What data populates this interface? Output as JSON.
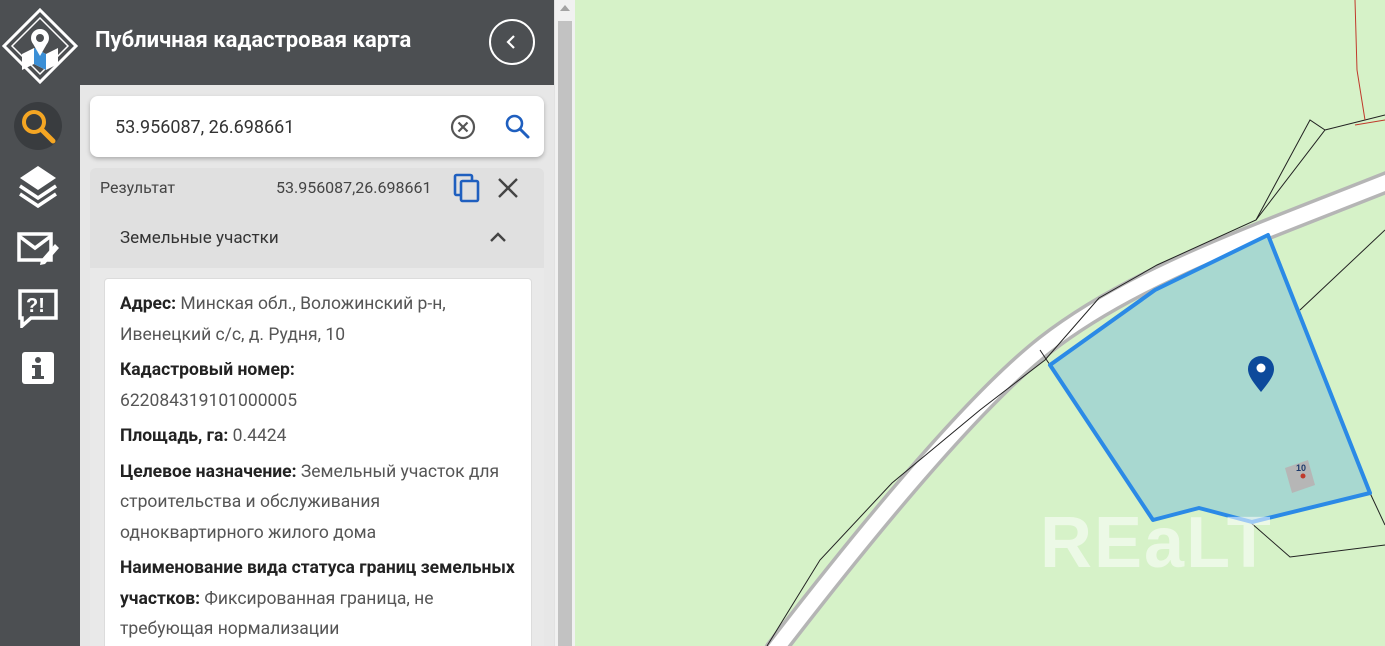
{
  "app": {
    "title": "Публичная кадастровая карта"
  },
  "nav": {
    "items": [
      {
        "name": "search",
        "icon": "search-icon",
        "active": true
      },
      {
        "name": "layers",
        "icon": "layers-icon",
        "active": false
      },
      {
        "name": "feedback",
        "icon": "mail-edit-icon",
        "active": false
      },
      {
        "name": "help",
        "icon": "question-chat-icon",
        "active": false
      },
      {
        "name": "info",
        "icon": "info-icon",
        "active": false
      }
    ]
  },
  "search": {
    "value": "53.956087, 26.698661"
  },
  "result": {
    "label": "Результат",
    "coords": "53.956087,26.698661"
  },
  "section": {
    "title": "Земельные участки"
  },
  "parcel": {
    "address_label": "Адрес:",
    "address_value": "Минская обл., Воложинский р-н, Ивенецкий с/с, д. Рудня, 10",
    "cadastral_label": "Кадастровый номер:",
    "cadastral_value": "622084319101000005",
    "area_label": "Площадь, га:",
    "area_value": "0.4424",
    "purpose_label": "Целевое назначение:",
    "purpose_value": "Земельный участок для строительства и обслуживания одноквартирного жилого дома",
    "boundary_label": "Наименование вида статуса границ земельных участков:",
    "boundary_value": "Фиксированная граница, не требующая нормализации"
  },
  "map": {
    "building_number": "10",
    "watermark": "REaLT",
    "colors": {
      "background": "#d6f2c8",
      "parcel_fill": "#a8d8d0",
      "parcel_stroke": "#2b8ae6",
      "marker": "#0d4a9b",
      "accent": "#f5a623"
    }
  }
}
